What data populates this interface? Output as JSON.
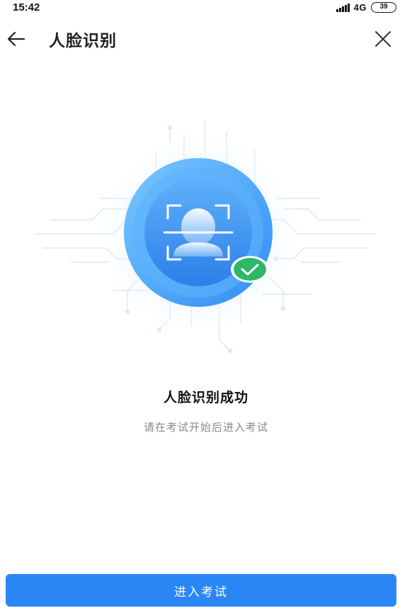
{
  "status_bar": {
    "time": "15:42",
    "network": "4G",
    "battery": "39"
  },
  "header": {
    "title": "人脸识别",
    "back_icon": "arrow-left-icon",
    "close_icon": "close-icon"
  },
  "result": {
    "title": "人脸识别成功",
    "subtitle": "请在考试开始后进入考试",
    "icon": "face-scan-success-icon"
  },
  "action": {
    "enter_label": "进入考试"
  },
  "colors": {
    "primary": "#2b86f5",
    "success": "#2cb866",
    "subtitle": "#8a8a8a"
  }
}
